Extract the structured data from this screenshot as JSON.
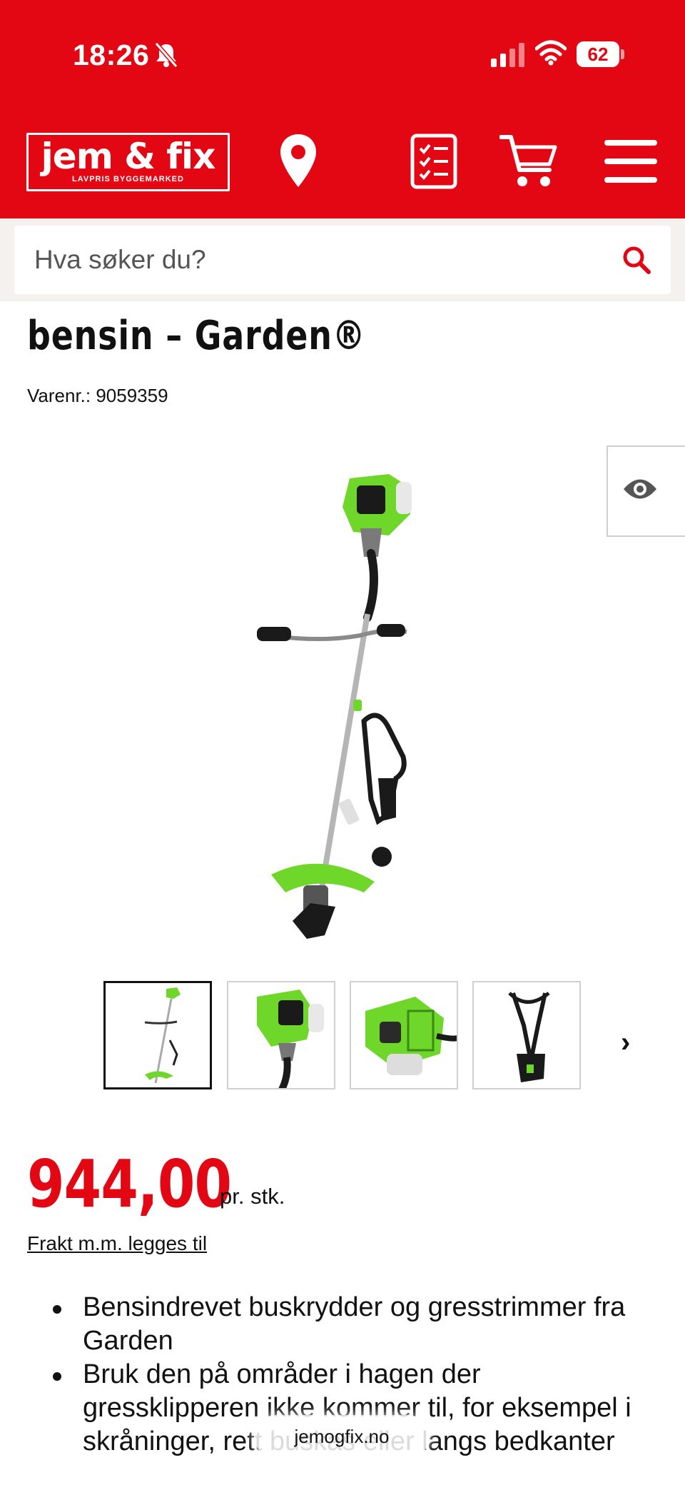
{
  "status_bar": {
    "time": "18:26",
    "battery": "62"
  },
  "brand": {
    "name": "jem & fix",
    "tagline": "LAVPRIS BYGGEMARKED",
    "accent_color": "#e30613"
  },
  "nav": {
    "icons": [
      "location-pin-icon",
      "shopping-list-icon",
      "cart-icon",
      "menu-icon"
    ]
  },
  "search": {
    "placeholder": "Hva søker du?",
    "icon": "search-icon"
  },
  "product": {
    "title": "bensin – Garden®",
    "sku": "Varenr.: 9059359",
    "view_icon": "eye-icon",
    "thumbnail_next": "›",
    "price": "944,00",
    "price_unit": "pr. stk.",
    "shipping_link": "Frakt m.m. legges til",
    "bullets": [
      "Bensindrevet buskrydder og gresstrimmer fra Garden",
      "Bruk den på områder i hagen der gressklipperen ikke kommer til, for eksempel i skråninger, rett buskas eller langs bedkanter"
    ]
  },
  "browser": {
    "url": "jemogfix.no"
  }
}
